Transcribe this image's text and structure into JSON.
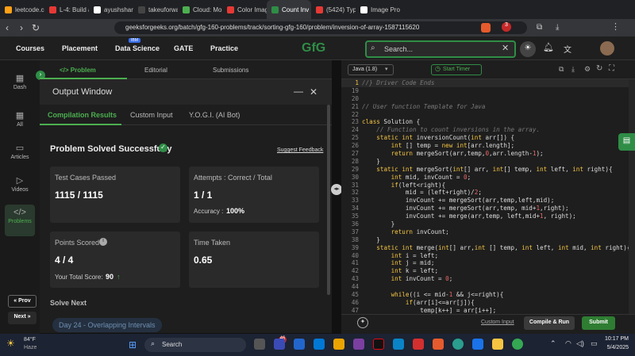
{
  "browser": {
    "tabs": [
      {
        "title": "leetcode.com",
        "color": "#ffa116"
      },
      {
        "title": "L-4: Build a Ca",
        "color": "#e53935"
      },
      {
        "title": "ayushsharma0",
        "color": "#ffffff"
      },
      {
        "title": "takeuforward",
        "color": "#444444"
      },
      {
        "title": "Cloud: Mongo",
        "color": "#4caf50"
      },
      {
        "title": "Color Image F",
        "color": "#e53935"
      },
      {
        "title": "Count Inv",
        "color": "#2f8d46"
      },
      {
        "title": "(5424) Types c",
        "color": "#e53935"
      },
      {
        "title": "Image Proces",
        "color": "#ffffff"
      }
    ],
    "url": "geeksforgeeks.org/batch/gfg-160-problems/track/sorting-gfg-160/problem/inversion-of-array-1587115620",
    "ext_badge": "3"
  },
  "site": {
    "logo": "GfG",
    "nav": [
      "Courses",
      "Placement",
      "Data Science",
      "GATE",
      "Practice"
    ],
    "ibm": "IBM",
    "search_placeholder": "Search..."
  },
  "rail": [
    {
      "label": "Dash",
      "icon": "▦"
    },
    {
      "label": "All",
      "icon": "▦"
    },
    {
      "label": "Articles",
      "icon": "▭"
    },
    {
      "label": "Videos",
      "icon": "▷"
    },
    {
      "label": "Problems",
      "icon": "</>"
    }
  ],
  "prev": "« Prov",
  "next": "Next »",
  "problem_tabs": [
    "</> Problem",
    "Editorial",
    "Submissions"
  ],
  "output": {
    "title": "Output Window",
    "tabs": [
      "Compilation Results",
      "Custom Input",
      "Y.O.G.I. (AI Bot)"
    ],
    "status": "Problem Solved Successfully",
    "feedback": "Suggest Feedback",
    "cards": {
      "tests_label": "Test Cases Passed",
      "tests_val": "1115 / 1115",
      "attempts_label": "Attempts : Correct / Total",
      "attempts_val": "1 / 1",
      "accuracy_label": "Accuracy :",
      "accuracy_val": "100%",
      "points_label": "Points Scored",
      "points_val": "4 / 4",
      "total_label": "Your Total Score:",
      "total_val": "90",
      "time_label": "Time Taken",
      "time_val": "0.65"
    },
    "solve_next": "Solve Next",
    "next_problem": "Day 24 - Overlapping Intervals"
  },
  "editor": {
    "language": "Java (1.8)",
    "timer": "Start Timer",
    "lines": [
      {
        "n": "1",
        "t": "//} Driver Code Ends"
      },
      {
        "n": "19",
        "t": ""
      },
      {
        "n": "20",
        "t": ""
      },
      {
        "n": "21",
        "t": "// User function Template for Java"
      },
      {
        "n": "22",
        "t": ""
      },
      {
        "n": "23",
        "t": "class Solution {"
      },
      {
        "n": "24",
        "t": "    // Function to count inversions in the array."
      },
      {
        "n": "25",
        "t": "    static int inversionCount(int arr[]) {"
      },
      {
        "n": "26",
        "t": "        int [] temp = new int[arr.length];"
      },
      {
        "n": "27",
        "t": "        return mergeSort(arr,temp,0,arr.length-1);"
      },
      {
        "n": "28",
        "t": "    }"
      },
      {
        "n": "29",
        "t": "    static int mergeSort(int[] arr, int[] temp, int left, int right){"
      },
      {
        "n": "30",
        "t": "        int mid, invCount = 0;"
      },
      {
        "n": "31",
        "t": "        if(left<right){"
      },
      {
        "n": "32",
        "t": "            mid = (left+right)/2;"
      },
      {
        "n": "33",
        "t": "            invCount += mergeSort(arr,temp,left,mid);"
      },
      {
        "n": "34",
        "t": "            invCount += mergeSort(arr,temp, mid+1,right);"
      },
      {
        "n": "35",
        "t": "            invCount += merge(arr,temp, left,mid+1, right);"
      },
      {
        "n": "36",
        "t": "        }"
      },
      {
        "n": "37",
        "t": "        return invCount;"
      },
      {
        "n": "38",
        "t": "    }"
      },
      {
        "n": "39",
        "t": "    static int merge(int[] arr,int [] temp, int left, int mid, int right){"
      },
      {
        "n": "40",
        "t": "        int i = left;"
      },
      {
        "n": "41",
        "t": "        int j = mid;"
      },
      {
        "n": "42",
        "t": "        int k = left;"
      },
      {
        "n": "43",
        "t": "        int invCount = 0;"
      },
      {
        "n": "44",
        "t": ""
      },
      {
        "n": "45",
        "t": "        while((i <= mid-1 && j<=right){"
      },
      {
        "n": "46",
        "t": "            if(arr[i]<=arr[j]){"
      },
      {
        "n": "47",
        "t": "                temp[k++] = arr[i++];"
      }
    ],
    "custom_input": "Custom Input",
    "compile": "Compile & Run",
    "submit": "Submit"
  },
  "taskbar": {
    "weather": "84°F",
    "weather_sub": "Haze",
    "search": "Search",
    "time": "10:17 PM",
    "date": "5/4/2025",
    "badge": "46"
  },
  "colors": {
    "accent": "#2f8d46",
    "submit": "#2e7d32"
  }
}
